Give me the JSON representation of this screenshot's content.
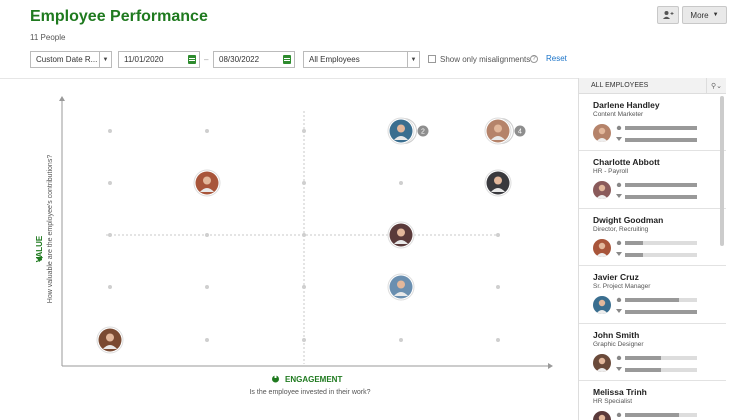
{
  "header": {
    "title": "Employee Performance",
    "subtitle": "11 People",
    "more_label": "More"
  },
  "filters": {
    "date_range": "Custom Date R...",
    "start_date": "11/01/2020",
    "date_separator": "–",
    "end_date": "08/30/2022",
    "employee_scope": "All Employees",
    "misalignments_label": "Show only misalignments",
    "misalignments_checked": false,
    "reset_label": "Reset"
  },
  "chart": {
    "y_title": "VALUE",
    "y_subtitle": "How valuable are the employee's contributions?",
    "x_title": "ENGAGEMENT",
    "x_subtitle": "Is the employee invested in their work?",
    "accent": "#1f7a1f",
    "grid_levels": 5,
    "markers": [
      {
        "engagement": 1,
        "value": 1,
        "avatar_color": "#7a4a32",
        "count": ""
      },
      {
        "engagement": 2,
        "value": 4,
        "avatar_color": "#a8553a",
        "count": ""
      },
      {
        "engagement": 4,
        "value": 5,
        "avatar_color": "#3a6e8f",
        "count": "2"
      },
      {
        "engagement": 5,
        "value": 5,
        "avatar_color": "#b5836a",
        "count": "4"
      },
      {
        "engagement": 5,
        "value": 4,
        "avatar_color": "#39393d",
        "count": ""
      },
      {
        "engagement": 4,
        "value": 3,
        "avatar_color": "#5a3a3a",
        "count": ""
      },
      {
        "engagement": 4,
        "value": 2,
        "avatar_color": "#6a8fb0",
        "count": ""
      }
    ]
  },
  "panel": {
    "title": "ALL EMPLOYEES",
    "employees": [
      {
        "name": "Darlene Handley",
        "title": "Content Marketer",
        "avatar_color": "#b5836a",
        "engagement": 1.0,
        "value": 1.0
      },
      {
        "name": "Charlotte Abbott",
        "title": "HR - Payroll",
        "avatar_color": "#8a5a5a",
        "engagement": 1.0,
        "value": 1.0
      },
      {
        "name": "Dwight Goodman",
        "title": "Director, Recruiting",
        "avatar_color": "#a8553a",
        "engagement": 0.25,
        "value": 0.25
      },
      {
        "name": "Javier Cruz",
        "title": "Sr. Project Manager",
        "avatar_color": "#3a6e8f",
        "engagement": 0.75,
        "value": 1.0
      },
      {
        "name": "John Smith",
        "title": "Graphic Designer",
        "avatar_color": "#6a4a3a",
        "engagement": 0.5,
        "value": 0.5
      },
      {
        "name": "Melissa Trinh",
        "title": "HR Specialist",
        "avatar_color": "#5a3a3a",
        "engagement": 0.75,
        "value": 0.75
      }
    ]
  }
}
